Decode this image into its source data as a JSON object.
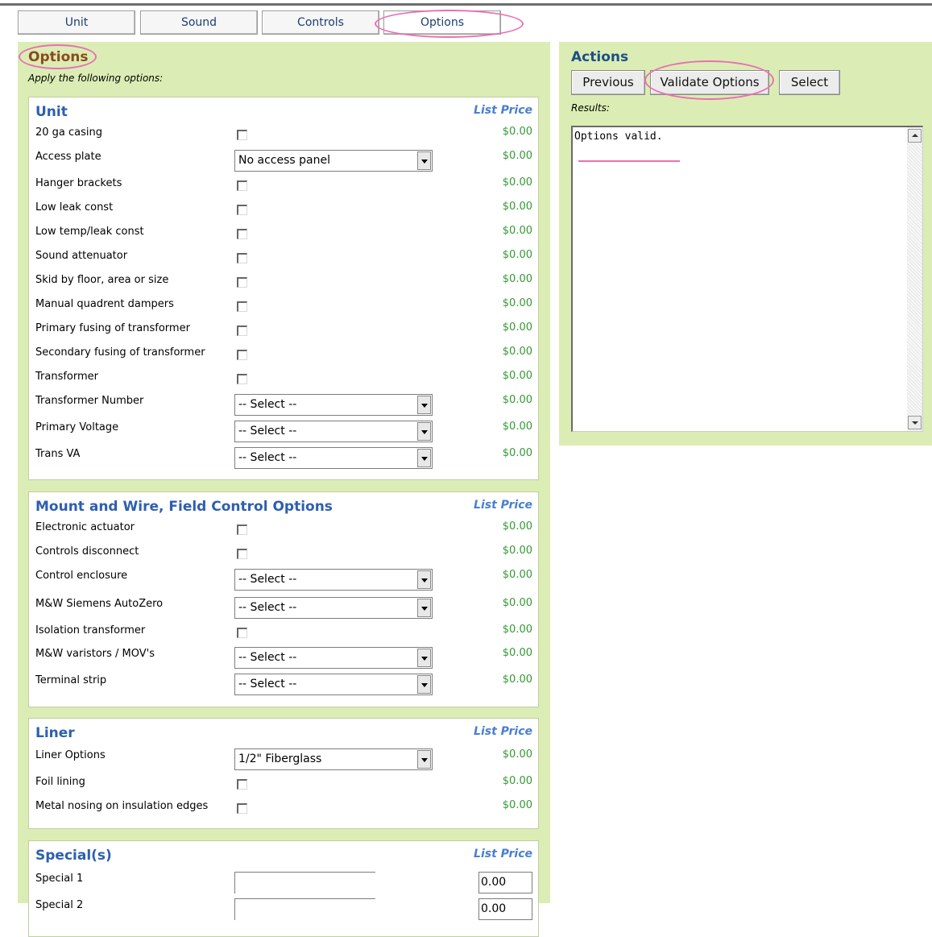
{
  "tabs": [
    {
      "label": "Unit"
    },
    {
      "label": "Sound"
    },
    {
      "label": "Controls"
    },
    {
      "label": "Options"
    }
  ],
  "options_panel": {
    "title": "Options",
    "subtitle": "Apply the following options:",
    "list_price_label": "List Price",
    "sections": [
      {
        "title": "Unit",
        "rows": [
          {
            "label": "20 ga casing",
            "control": "checkbox",
            "price": "$0.00"
          },
          {
            "label": "Access plate",
            "control": "select",
            "value": "No access panel",
            "price": "$0.00"
          },
          {
            "label": "Hanger brackets",
            "control": "checkbox",
            "price": "$0.00"
          },
          {
            "label": "Low leak const",
            "control": "checkbox",
            "price": "$0.00"
          },
          {
            "label": "Low temp/leak const",
            "control": "checkbox",
            "price": "$0.00"
          },
          {
            "label": "Sound attenuator",
            "control": "checkbox",
            "price": "$0.00"
          },
          {
            "label": "Skid by floor, area or size",
            "control": "checkbox",
            "price": "$0.00"
          },
          {
            "label": "Manual quadrent dampers",
            "control": "checkbox",
            "price": "$0.00"
          },
          {
            "label": "Primary fusing of transformer",
            "control": "checkbox",
            "price": "$0.00"
          },
          {
            "label": "Secondary fusing of transformer",
            "control": "checkbox",
            "price": "$0.00"
          },
          {
            "label": "Transformer",
            "control": "checkbox",
            "price": "$0.00"
          },
          {
            "label": "Transformer Number",
            "control": "select",
            "value": "-- Select --",
            "price": "$0.00"
          },
          {
            "label": "Primary Voltage",
            "control": "select",
            "value": "-- Select --",
            "price": "$0.00"
          },
          {
            "label": "Trans VA",
            "control": "select",
            "value": "-- Select --",
            "price": "$0.00"
          }
        ]
      },
      {
        "title": "Mount and Wire, Field Control Options",
        "rows": [
          {
            "label": "Electronic actuator",
            "control": "checkbox",
            "price": "$0.00"
          },
          {
            "label": "Controls disconnect",
            "control": "checkbox",
            "price": "$0.00"
          },
          {
            "label": "Control enclosure",
            "control": "select",
            "value": "-- Select --",
            "price": "$0.00"
          },
          {
            "label": "M&W Siemens AutoZero",
            "control": "select",
            "value": "-- Select --",
            "price": "$0.00"
          },
          {
            "label": "Isolation transformer",
            "control": "checkbox",
            "price": "$0.00"
          },
          {
            "label": "M&W varistors / MOV's",
            "control": "select",
            "value": "-- Select --",
            "price": "$0.00"
          },
          {
            "label": "Terminal strip",
            "control": "select",
            "value": "-- Select --",
            "price": "$0.00"
          }
        ]
      },
      {
        "title": "Liner",
        "rows": [
          {
            "label": "Liner Options",
            "control": "select",
            "value": "1/2\" Fiberglass",
            "price": "$0.00"
          },
          {
            "label": "Foil lining",
            "control": "checkbox",
            "price": "$0.00"
          },
          {
            "label": "Metal nosing on insulation edges",
            "control": "checkbox",
            "price": "$0.00"
          }
        ]
      },
      {
        "title": "Special(s)",
        "rows": [
          {
            "label": "Special 1",
            "control": "text",
            "currency": "$",
            "amount": "0.00"
          },
          {
            "label": "Special 2",
            "control": "text",
            "currency": "$",
            "amount": "0.00"
          }
        ]
      }
    ]
  },
  "actions_panel": {
    "title": "Actions",
    "buttons": {
      "previous": "Previous",
      "validate": "Validate Options",
      "select": "Select"
    },
    "results_label": "Results:",
    "results_text": "Options valid."
  },
  "colors": {
    "panel_bg": "#dbedb5",
    "section_title": "#2d5fb0",
    "price": "#339933",
    "panel_title": "#8a4b1f",
    "annotation": "#ea6fb3"
  }
}
